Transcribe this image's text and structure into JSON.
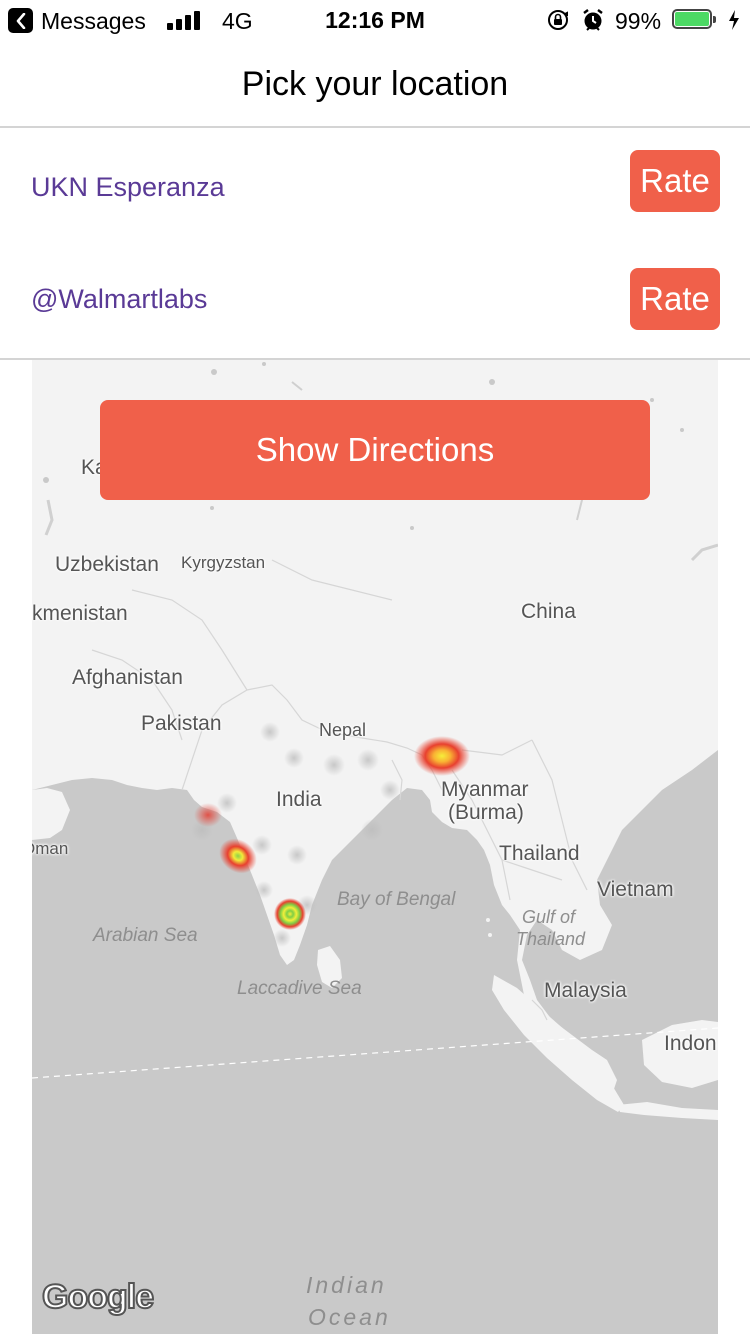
{
  "status_bar": {
    "back_app": "Messages",
    "network": "4G",
    "time": "12:16 PM",
    "battery_percent": "99%",
    "battery_level": 0.99,
    "signal_bars": 4,
    "icons": [
      "back-arrow-icon",
      "signal-icon",
      "orientation-lock-icon",
      "alarm-icon",
      "battery-icon",
      "charging-bolt-icon"
    ]
  },
  "header": {
    "title": "Pick your location"
  },
  "locations": [
    {
      "name": "UKN Esperanza",
      "action_label": "Rate"
    },
    {
      "name": "@Walmartlabs",
      "action_label": "Rate"
    }
  ],
  "directions_button": {
    "label": "Show Directions"
  },
  "map": {
    "land_color": "#f3f3f3",
    "water_color": "#c9c9c9",
    "labels": {
      "ka": "Ka",
      "uzbekistan": "Uzbekistan",
      "kyrgyzstan": "Kyrgyzstan",
      "turkmenistan": "kmenistan",
      "china": "China",
      "afghanistan": "Afghanistan",
      "pakistan": "Pakistan",
      "nepal": "Nepal",
      "india": "India",
      "myanmar": "Myanmar",
      "burma": "(Burma)",
      "oman": "Oman",
      "thailand": "Thailand",
      "vietnam": "Vietnam",
      "bay_of_bengal": "Bay of Bengal",
      "gulf_of": "Gulf of",
      "gulf_thailand": "Thailand",
      "arabian_sea": "Arabian Sea",
      "laccadive_sea": "Laccadive Sea",
      "malaysia": "Malaysia",
      "indonesia": "Indon",
      "indian": "Indian",
      "ocean": "Ocean"
    },
    "attribution": "Google"
  }
}
